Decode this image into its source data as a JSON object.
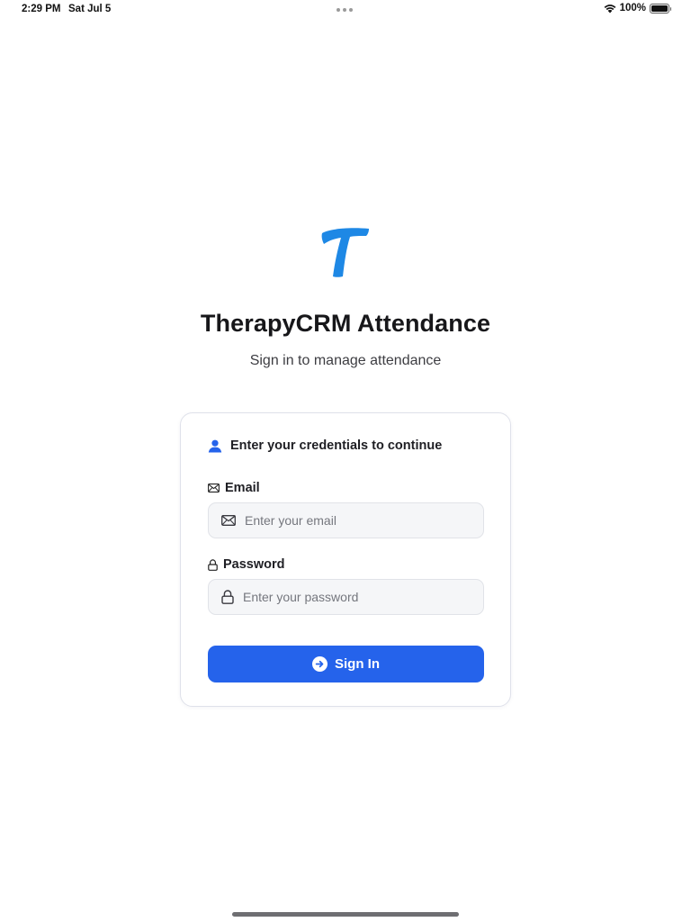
{
  "status_bar": {
    "time": "2:29 PM",
    "date": "Sat Jul 5",
    "battery": "100%"
  },
  "app": {
    "title": "TherapyCRM Attendance",
    "subtitle": "Sign in to manage attendance"
  },
  "login_card": {
    "header": "Enter your credentials to continue",
    "email": {
      "label": "Email",
      "value": "",
      "placeholder": "Enter your email"
    },
    "password": {
      "label": "Password",
      "value": "",
      "placeholder": "Enter your password"
    },
    "signin_label": "Sign In"
  },
  "icons": {
    "logo": "letter-t-logo",
    "header": "person-icon",
    "email": "envelope-icon",
    "password": "lock-icon",
    "signin": "arrow-right-circle-icon"
  },
  "colors": {
    "accent": "#2563eb",
    "logo": "#1e88e5",
    "input_bg": "#f5f6f8"
  }
}
